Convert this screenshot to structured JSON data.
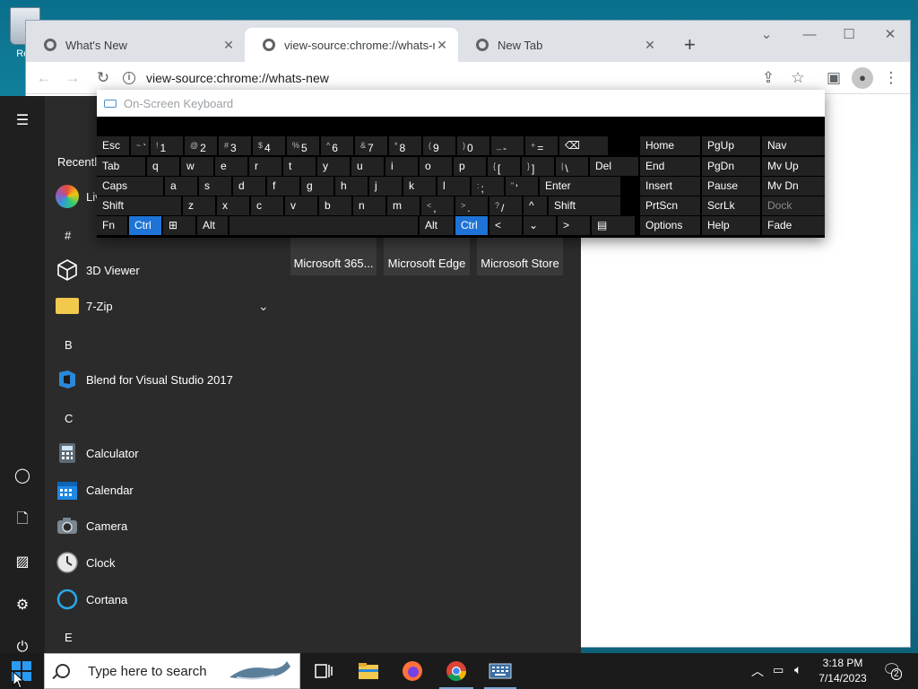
{
  "desktop": {
    "recycle_label": "Rec"
  },
  "browser": {
    "tabs": [
      {
        "title": "What's New"
      },
      {
        "title": "view-source:chrome://whats-new"
      },
      {
        "title": "New Tab"
      }
    ],
    "address": "view-source:chrome://whats-new"
  },
  "start_menu": {
    "recently_added": "Recently added",
    "letters": {
      "hash": "#",
      "b": "B",
      "c": "C",
      "e": "E"
    },
    "apps": {
      "live": "Live",
      "viewer3d": "3D Viewer",
      "zip": "7-Zip",
      "blend": "Blend for Visual Studio 2017",
      "calculator": "Calculator",
      "calendar": "Calendar",
      "camera": "Camera",
      "clock": "Clock",
      "cortana": "Cortana"
    },
    "tiles": [
      "Microsoft 365...",
      "Microsoft Edge",
      "Microsoft Store"
    ]
  },
  "osk": {
    "title": "On-Screen Keyboard",
    "row1": [
      {
        "l": "Esc"
      },
      {
        "s": "~",
        "l": "`"
      },
      {
        "s": "!",
        "l": "1"
      },
      {
        "s": "@",
        "l": "2"
      },
      {
        "s": "#",
        "l": "3"
      },
      {
        "s": "$",
        "l": "4"
      },
      {
        "s": "%",
        "l": "5"
      },
      {
        "s": "^",
        "l": "6"
      },
      {
        "s": "&",
        "l": "7"
      },
      {
        "s": "*",
        "l": "8"
      },
      {
        "s": "(",
        "l": "9"
      },
      {
        "s": ")",
        "l": "0"
      },
      {
        "s": "_",
        "l": "-"
      },
      {
        "s": "+",
        "l": "="
      },
      {
        "l": "⌫"
      }
    ],
    "row2": [
      {
        "l": "Tab"
      },
      {
        "l": "q"
      },
      {
        "l": "w"
      },
      {
        "l": "e"
      },
      {
        "l": "r"
      },
      {
        "l": "t"
      },
      {
        "l": "y"
      },
      {
        "l": "u"
      },
      {
        "l": "i"
      },
      {
        "l": "o"
      },
      {
        "l": "p"
      },
      {
        "s": "{",
        "l": "["
      },
      {
        "s": "}",
        "l": "]"
      },
      {
        "s": "|",
        "l": "\\"
      },
      {
        "l": "Del"
      }
    ],
    "row3": [
      {
        "l": "Caps"
      },
      {
        "l": "a"
      },
      {
        "l": "s"
      },
      {
        "l": "d"
      },
      {
        "l": "f"
      },
      {
        "l": "g"
      },
      {
        "l": "h"
      },
      {
        "l": "j"
      },
      {
        "l": "k"
      },
      {
        "l": "l"
      },
      {
        "s": ":",
        "l": ";"
      },
      {
        "s": "\"",
        "l": "'"
      },
      {
        "l": "Enter"
      }
    ],
    "row4": [
      {
        "l": "Shift"
      },
      {
        "l": "z"
      },
      {
        "l": "x"
      },
      {
        "l": "c"
      },
      {
        "l": "v"
      },
      {
        "l": "b"
      },
      {
        "l": "n"
      },
      {
        "l": "m"
      },
      {
        "s": "<",
        "l": ","
      },
      {
        "s": ">",
        "l": "."
      },
      {
        "s": "?",
        "l": "/"
      },
      {
        "l": "^"
      },
      {
        "l": "Shift"
      }
    ],
    "row5": [
      {
        "l": "Fn"
      },
      {
        "l": "Ctrl"
      },
      {
        "l": "⊞"
      },
      {
        "l": "Alt"
      },
      {
        "l": ""
      },
      {
        "l": "Alt"
      },
      {
        "l": "Ctrl"
      },
      {
        "l": "<"
      },
      {
        "l": "⌄"
      },
      {
        "l": ">"
      },
      {
        "l": "▤"
      }
    ],
    "side": [
      [
        "Home",
        "PgUp",
        "Nav"
      ],
      [
        "End",
        "PgDn",
        "Mv Up"
      ],
      [
        "Insert",
        "Pause",
        "Mv Dn"
      ],
      [
        "PrtScn",
        "ScrLk",
        "Dock"
      ],
      [
        "Options",
        "Help",
        "Fade"
      ]
    ]
  },
  "taskbar": {
    "search_placeholder": "Type here to search",
    "time": "3:18 PM",
    "date": "7/14/2023",
    "notification_count": "2"
  }
}
